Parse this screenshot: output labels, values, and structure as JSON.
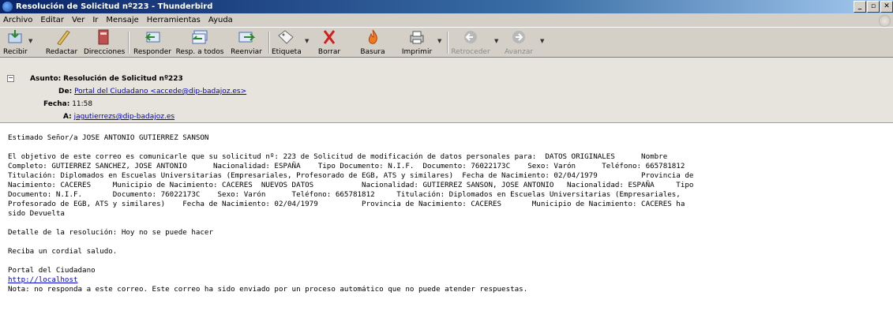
{
  "window": {
    "title": "Resolución de Solicitud nº223 - Thunderbird",
    "controls": [
      "_",
      "▫",
      "✕"
    ]
  },
  "menu": [
    "Archivo",
    "Editar",
    "Ver",
    "Ir",
    "Mensaje",
    "Herramientas",
    "Ayuda"
  ],
  "toolbar": {
    "recibir": "Recibir",
    "redactar": "Redactar",
    "direcciones": "Direcciones",
    "responder": "Responder",
    "resp_todos": "Resp. a todos",
    "reenviar": "Reenviar",
    "etiqueta": "Etiqueta",
    "borrar": "Borrar",
    "basura": "Basura",
    "imprimir": "Imprimir",
    "retroceder": "Retroceder",
    "avanzar": "Avanzar"
  },
  "headers": {
    "subject_label": "Asunto:",
    "subject": "Resolución de Solicitud nº223",
    "from_label": "De:",
    "from": "Portal del Ciudadano <accede@dip-badajoz.es>",
    "date_label": "Fecha:",
    "date": "11:58",
    "to_label": "A:",
    "to": "jagutierrezs@dip-badajoz.es"
  },
  "body": {
    "greeting": "Estimado Señor/a JOSE ANTONIO GUTIERREZ SANSON",
    "main_lines": [
      "El objetivo de este correo es comunicarle que su solicitud nº: 223 de Solicitud de modificación de datos personales para:  DATOS ORIGINALES      Nombre",
      "Completo: GUTIERREZ SANCHEZ, JOSE ANTONIO      Nacionalidad: ESPAÑA    Tipo Documento: N.I.F.  Documento: 76022173C    Sexo: Varón      Teléfono: 665781812",
      "Titulación: Diplomados en Escuelas Universitarias (Empresariales, Profesorado de EGB, ATS y similares)  Fecha de Nacimiento: 02/04/1979          Provincia de",
      "Nacimiento: CACERES     Municipio de Nacimiento: CACERES  NUEVOS DATOS           Nacionalidad: GUTIERREZ SANSON, JOSE ANTONIO   Nacionalidad: ESPAÑA     Tipo",
      "Documento: N.I.F.       Documento: 76022173C    Sexo: Varón      Teléfono: 665781812     Titulación: Diplomados en Escuelas Universitarias (Empresariales,",
      "Profesorado de EGB, ATS y similares)    Fecha de Nacimiento: 02/04/1979          Provincia de Nacimiento: CACERES       Municipio de Nacimiento: CACERES ha",
      "sido Devuelta"
    ],
    "detail": "Detalle de la resolución: Hoy no se puede hacer",
    "closing": "Reciba un cordial saludo.",
    "signature": "Portal del Ciudadano",
    "link": "http://localhost",
    "note": "Nota: no responda a este correo. Este correo ha sido enviado por un proceso automático que no puede atender respuestas."
  },
  "colors": {
    "titlebar_start": "#0a246a",
    "chrome": "#d4d0c8",
    "header_pane": "#e6e4dd",
    "link": "#0000cc"
  }
}
